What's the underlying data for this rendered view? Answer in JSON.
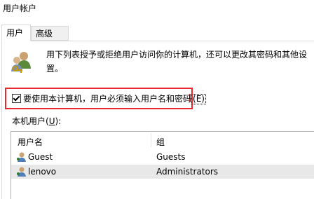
{
  "window": {
    "title": "用户帐户"
  },
  "tabs": [
    {
      "label": "用户"
    },
    {
      "label": "高级"
    }
  ],
  "description": "用下列表授予或拒绝用户访问你的计算机，还可以更改其密码和其他设置。",
  "require_login": {
    "checked": true,
    "label": "要使用本计算机，用户必须输入用户名和密码",
    "access_key_display": "(E)"
  },
  "users_section": {
    "label_prefix": "本机用户(",
    "access_key": "U",
    "label_suffix": "):"
  },
  "columns": [
    "用户名",
    "组"
  ],
  "rows": [
    {
      "name": "Guest",
      "group": "Guests",
      "selected": false
    },
    {
      "name": "lenovo",
      "group": "Administrators",
      "selected": true
    }
  ],
  "icons": {
    "users": "users-icon",
    "user_row": "user-icon"
  },
  "colors": {
    "highlight_box": "#e8272f",
    "selected_row": "#e8e8e8"
  }
}
